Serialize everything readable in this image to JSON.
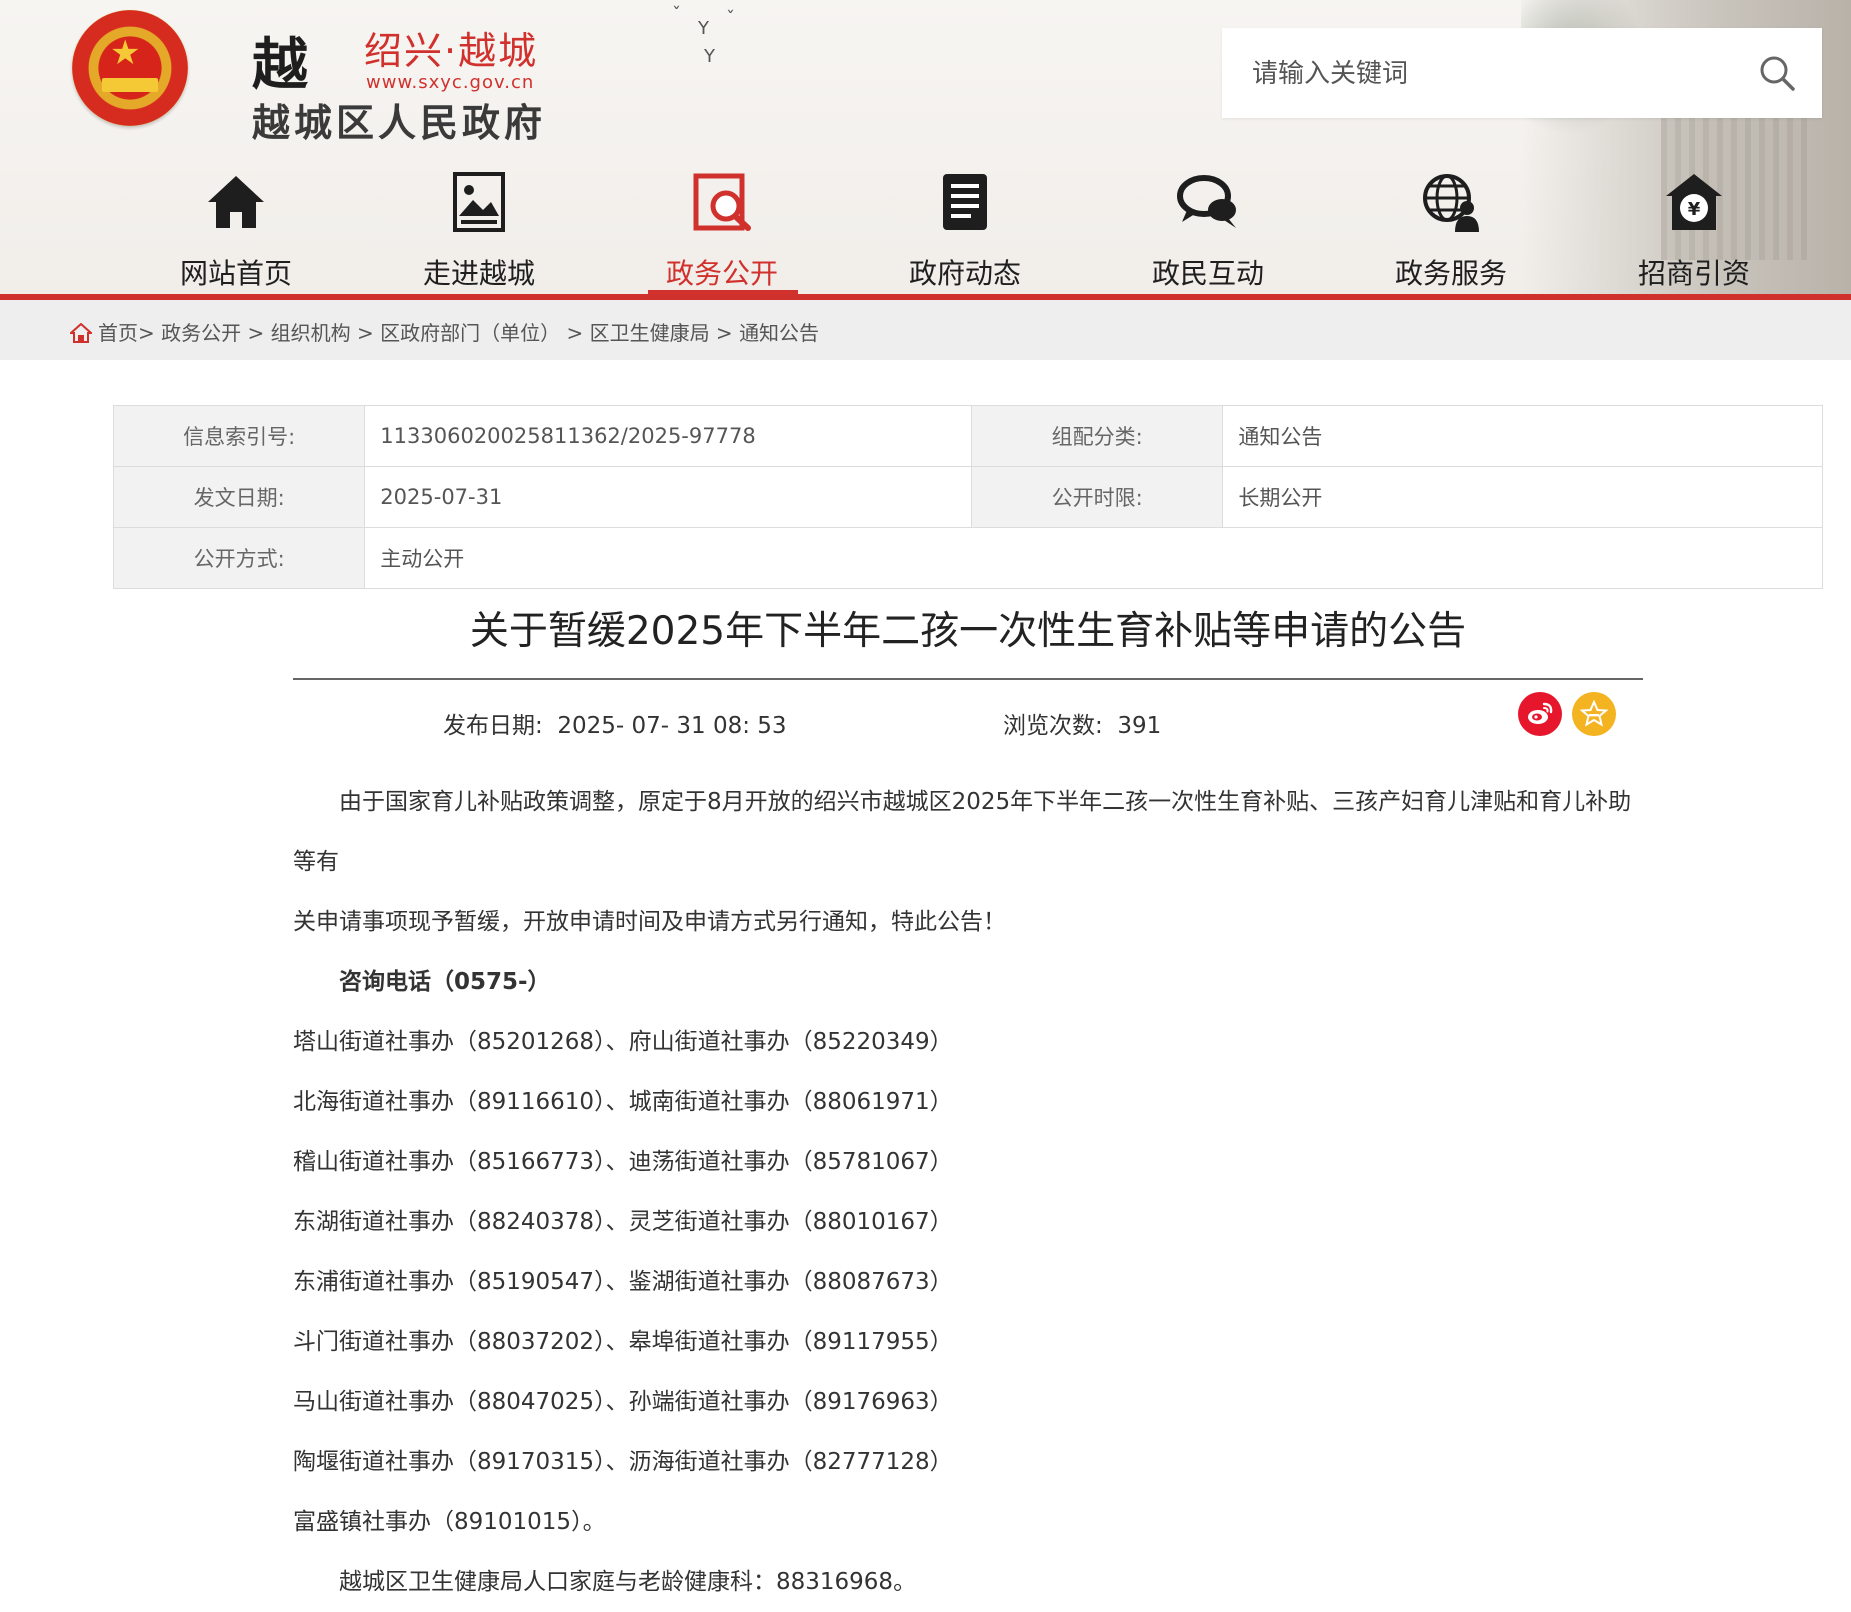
{
  "header": {
    "logo_mark": "越",
    "site_name": "绍兴·越城",
    "site_url": "www.sxyc.gov.cn",
    "site_title": "越城区人民政府"
  },
  "search": {
    "placeholder": "请输入关键词"
  },
  "nav": {
    "items": [
      {
        "label": "网站首页",
        "icon": "home-icon"
      },
      {
        "label": "走进越城",
        "icon": "picture-icon"
      },
      {
        "label": "政务公开",
        "icon": "document-search-icon"
      },
      {
        "label": "政府动态",
        "icon": "news-icon"
      },
      {
        "label": "政民互动",
        "icon": "chat-icon"
      },
      {
        "label": "政务服务",
        "icon": "globe-user-icon"
      },
      {
        "label": "招商引资",
        "icon": "yuan-house-icon"
      }
    ],
    "active_index": 2
  },
  "breadcrumb": {
    "items": [
      "首页",
      "政务公开",
      "组织机构",
      "区政府部门（单位）",
      "区卫生健康局",
      "通知公告"
    ]
  },
  "meta": {
    "index_no_label": "信息索引号:",
    "index_no": "11330602002581136​2/2025-97778",
    "category_label": "组配分类:",
    "category": "通知公告",
    "issue_date_label": "发文日期:",
    "issue_date": "2025-07-31",
    "term_label": "公开时限:",
    "term": "长期公开",
    "mode_label": "公开方式:",
    "mode": "主动公开"
  },
  "article": {
    "title": "关于暂缓2025年下半年二孩一次性生育补贴等申请的公告",
    "publish_label": "发布日期:",
    "publish_date": "2025- 07- 31 08: 53",
    "views_label": "浏览次数:",
    "views": "391",
    "paragraph1_line1": "由于国家育儿补贴政策调整，原定于8月开放的绍兴市越城区2025年下半年二孩一次性生育补贴、三孩产妇育儿津贴和育儿补助等有",
    "paragraph1_line2": "关申请事项现予暂缓，开放申请时间及申请方式另行通知，特此公告！",
    "consult_heading": "咨询电话（0575-）",
    "contacts": [
      "塔山街道社事办（85201268）、府山街道社事办（85220349）",
      "北海街道社事办（89116610）、城南街道社事办（88061971）",
      "稽山街道社事办（85166773）、迪荡街道社事办（85781067）",
      "东湖街道社事办（88240378）、灵芝街道社事办（88010167）",
      "东浦街道社事办（85190547）、鉴湖街道社事办（88087673）",
      "斗门街道社事办（88037202）、皋埠街道社事办（89117955）",
      "马山街道社事办（88047025）、孙端街道社事办（89176963）",
      "陶堰街道社事办（89170315）、沥海街道社事办（82777128）",
      "富盛镇社事办（89101015）。"
    ],
    "footer_line": "越城区卫生健康局人口家庭与老龄健康科：88316968。"
  },
  "colors": {
    "brand_red": "#d0312d",
    "weibo_red": "#e6162d",
    "favorite_yellow": "#f4b321"
  }
}
